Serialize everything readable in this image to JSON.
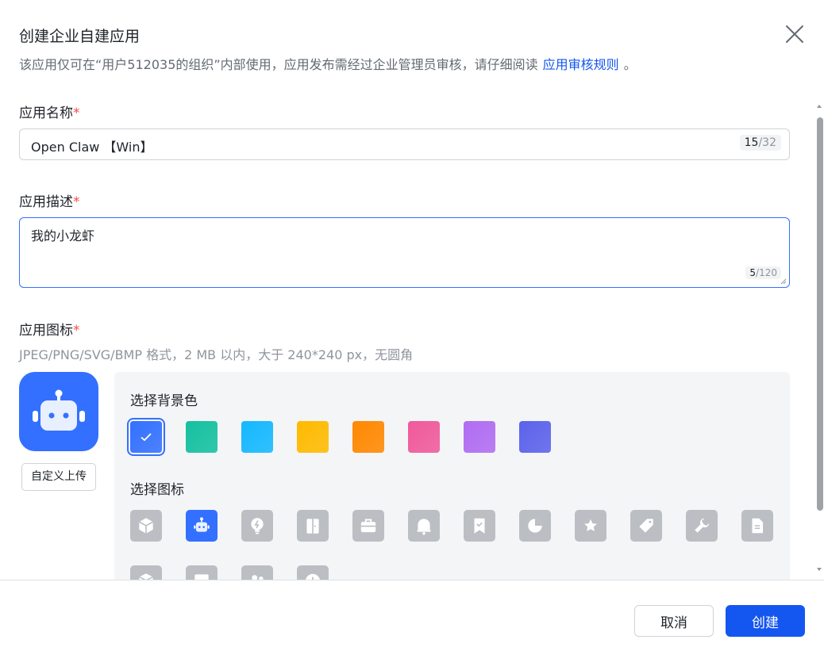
{
  "dialog": {
    "title": "创建企业自建应用",
    "subtitle": "该应用仅可在“用户512035的组织”内部使用，应用发布需经过企业管理员审核，请仔细阅读",
    "subtitle_link": "应用审核规则",
    "subtitle_end": "。"
  },
  "form": {
    "name": {
      "label": "应用名称",
      "required_mark": "*",
      "value": "Open Claw 【Win】",
      "count": "15",
      "max": "/32"
    },
    "description": {
      "label": "应用描述",
      "required_mark": "*",
      "value": "我的小龙虾",
      "count": "5",
      "max": "/120"
    },
    "icon": {
      "label": "应用图标",
      "required_mark": "*",
      "hint": "JPEG/PNG/SVG/BMP 格式，2 MB 以内，大于 240*240 px，无圆角",
      "upload_label": "自定义上传",
      "bg_section_label": "选择背景色",
      "icon_section_label": "选择图标",
      "bg_colors": [
        "#3370ff",
        "#14c0a0",
        "#14b8ff",
        "#ffba00",
        "#ff8800",
        "#f0599b",
        "#b06cf2",
        "#5b62eb"
      ],
      "selected_bg": 0,
      "icons": [
        "cube-icon",
        "robot-icon",
        "bulb-icon",
        "door-icon",
        "briefcase-icon",
        "bell-icon",
        "bookmark-check-icon",
        "pie-chart-icon",
        "star-icon",
        "tag-icon",
        "wrench-icon",
        "document-icon",
        "box-icon",
        "monitor-icon",
        "people-icon",
        "clock-icon"
      ],
      "selected_icon": 1
    }
  },
  "footer": {
    "cancel_label": "取消",
    "create_label": "创建"
  }
}
